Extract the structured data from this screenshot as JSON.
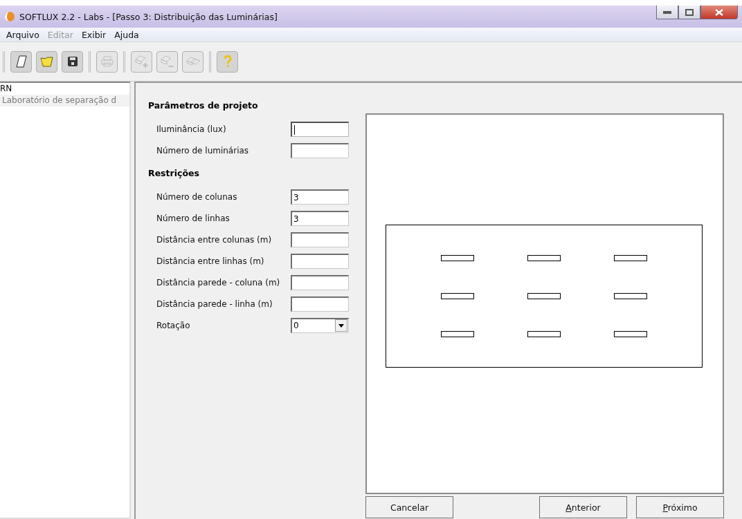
{
  "window": {
    "title": "SOFTLUX 2.2 - Labs - [Passo 3: Distribuição das Luminárias]"
  },
  "menu": [
    {
      "label": "Arquivo",
      "disabled": false
    },
    {
      "label": "Editar",
      "disabled": true
    },
    {
      "label": "Exibir",
      "disabled": false
    },
    {
      "label": "Ajuda",
      "disabled": false
    }
  ],
  "toolbar": [
    [
      {
        "kind": "new",
        "disabled": false
      },
      {
        "kind": "open",
        "disabled": false
      },
      {
        "kind": "save",
        "disabled": false
      }
    ],
    [
      {
        "kind": "print",
        "disabled": true
      }
    ],
    [
      {
        "kind": "add",
        "disabled": true
      },
      {
        "kind": "remove",
        "disabled": true
      },
      {
        "kind": "copy",
        "disabled": true
      }
    ],
    [
      {
        "kind": "help",
        "disabled": false
      }
    ]
  ],
  "tree": [
    {
      "label": "RN",
      "selected": false,
      "children": [
        {
          "label": "Laboratório de separação d",
          "selected": true
        }
      ]
    }
  ],
  "sections": [
    {
      "title": "Parâmetros de projeto",
      "fields": [
        {
          "kind": "text",
          "label": "Iluminância (lux)",
          "focused": true
        },
        {
          "kind": "text",
          "label": "Número de luminárias",
          "focused": false
        }
      ]
    },
    {
      "title": "Restrições",
      "fields": [
        {
          "kind": "text",
          "label": "Número de colunas",
          "value": "3",
          "focused": false
        },
        {
          "kind": "text",
          "label": "Número de linhas",
          "value": "3",
          "focused": false
        },
        {
          "kind": "text",
          "label": "Distância entre colunas (m)",
          "focused": false
        },
        {
          "kind": "text",
          "label": "Distância entre linhas (m)",
          "focused": false
        },
        {
          "kind": "text",
          "label": "Distância parede - coluna (m)",
          "focused": false
        },
        {
          "kind": "text",
          "label": "Distância parede - linha (m)",
          "focused": false
        },
        {
          "kind": "select",
          "label": "Rotação",
          "value": "0"
        }
      ]
    }
  ],
  "buttons": [
    {
      "label": "Cancelar",
      "mnemonic": false
    },
    {
      "label": "Anterior",
      "mnemonic": true
    },
    {
      "label": "Próximo",
      "mnemonic": true
    }
  ]
}
